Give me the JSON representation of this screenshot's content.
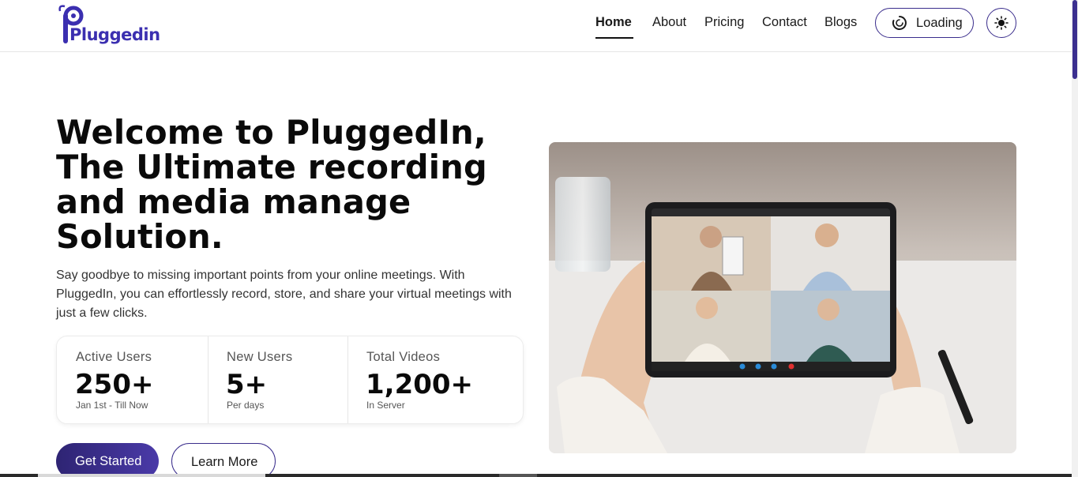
{
  "brand": {
    "logo_text": "Pluggedin",
    "accent_color": "#3b2fb0"
  },
  "nav": {
    "items": [
      {
        "label": "Home",
        "active": true
      },
      {
        "label": "About"
      },
      {
        "label": "Pricing"
      },
      {
        "label": "Contact"
      },
      {
        "label": "Blogs"
      }
    ],
    "loading_label": "Loading",
    "theme_icon": "sun-icon"
  },
  "hero": {
    "title": "Welcome to PluggedIn, The Ultimate recording and media manage Solution.",
    "description": "Say goodbye to missing important points from your online meetings. With PluggedIn, you can effortlessly record, store, and share your virtual meetings with just a few clicks.",
    "stats": [
      {
        "label": "Active Users",
        "value": "250+",
        "sub": "Jan 1st - Till Now"
      },
      {
        "label": "New Users",
        "value": "5+",
        "sub": "Per days"
      },
      {
        "label": "Total Videos",
        "value": "1,200+",
        "sub": "In Server"
      }
    ],
    "primary_button": "Get Started",
    "secondary_button": "Learn More"
  }
}
